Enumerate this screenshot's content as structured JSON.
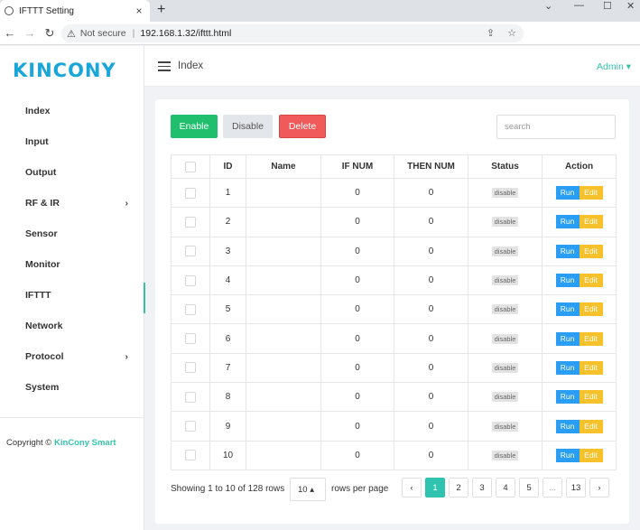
{
  "browser": {
    "tab_title": "IFTTT Setting",
    "tab_close": "×",
    "new_tab": "+",
    "security_label": "Not secure",
    "url": "192.168.1.32/ifttt.html"
  },
  "sidebar": {
    "logo": "KINCONY",
    "items": [
      {
        "label": "Index"
      },
      {
        "label": "Input"
      },
      {
        "label": "Output"
      },
      {
        "label": "RF & IR"
      },
      {
        "label": "Sensor"
      },
      {
        "label": "Monitor"
      },
      {
        "label": "IFTTT"
      },
      {
        "label": "Network"
      },
      {
        "label": "Protocol"
      },
      {
        "label": "System"
      }
    ],
    "copyright_prefix": "Copyright ©",
    "copyright_brand": "KinCony Smart"
  },
  "header": {
    "breadcrumb": "Index",
    "user": "Admin ▾"
  },
  "toolbar": {
    "enable_label": "Enable",
    "disable_label": "Disable",
    "delete_label": "Delete",
    "search_placeholder": "search"
  },
  "table": {
    "columns": [
      "ID",
      "Name",
      "IF NUM",
      "THEN NUM",
      "Status",
      "Action"
    ],
    "rows": [
      {
        "id": "1",
        "name": "",
        "if_num": "0",
        "then_num": "0",
        "status": "disable"
      },
      {
        "id": "2",
        "name": "",
        "if_num": "0",
        "then_num": "0",
        "status": "disable"
      },
      {
        "id": "3",
        "name": "",
        "if_num": "0",
        "then_num": "0",
        "status": "disable"
      },
      {
        "id": "4",
        "name": "",
        "if_num": "0",
        "then_num": "0",
        "status": "disable"
      },
      {
        "id": "5",
        "name": "",
        "if_num": "0",
        "then_num": "0",
        "status": "disable"
      },
      {
        "id": "6",
        "name": "",
        "if_num": "0",
        "then_num": "0",
        "status": "disable"
      },
      {
        "id": "7",
        "name": "",
        "if_num": "0",
        "then_num": "0",
        "status": "disable"
      },
      {
        "id": "8",
        "name": "",
        "if_num": "0",
        "then_num": "0",
        "status": "disable"
      },
      {
        "id": "9",
        "name": "",
        "if_num": "0",
        "then_num": "0",
        "status": "disable"
      },
      {
        "id": "10",
        "name": "",
        "if_num": "0",
        "then_num": "0",
        "status": "disable"
      }
    ],
    "run_label": "Run",
    "edit_label": "Edit"
  },
  "pagination": {
    "showing": "Showing 1 to 10 of 128 rows",
    "rows_per_page_value": "10 ▴",
    "rows_per_page_label": "rows per page",
    "prev": "‹",
    "pages": [
      "1",
      "2",
      "3",
      "4",
      "5",
      "...",
      "13"
    ],
    "next": "›",
    "active_page": "1"
  },
  "colors": {
    "accent": "#36c2a9",
    "enable": "#1fbf6e",
    "delete": "#f05a5a",
    "run": "#2a9df4",
    "edit": "#f7c12b"
  }
}
